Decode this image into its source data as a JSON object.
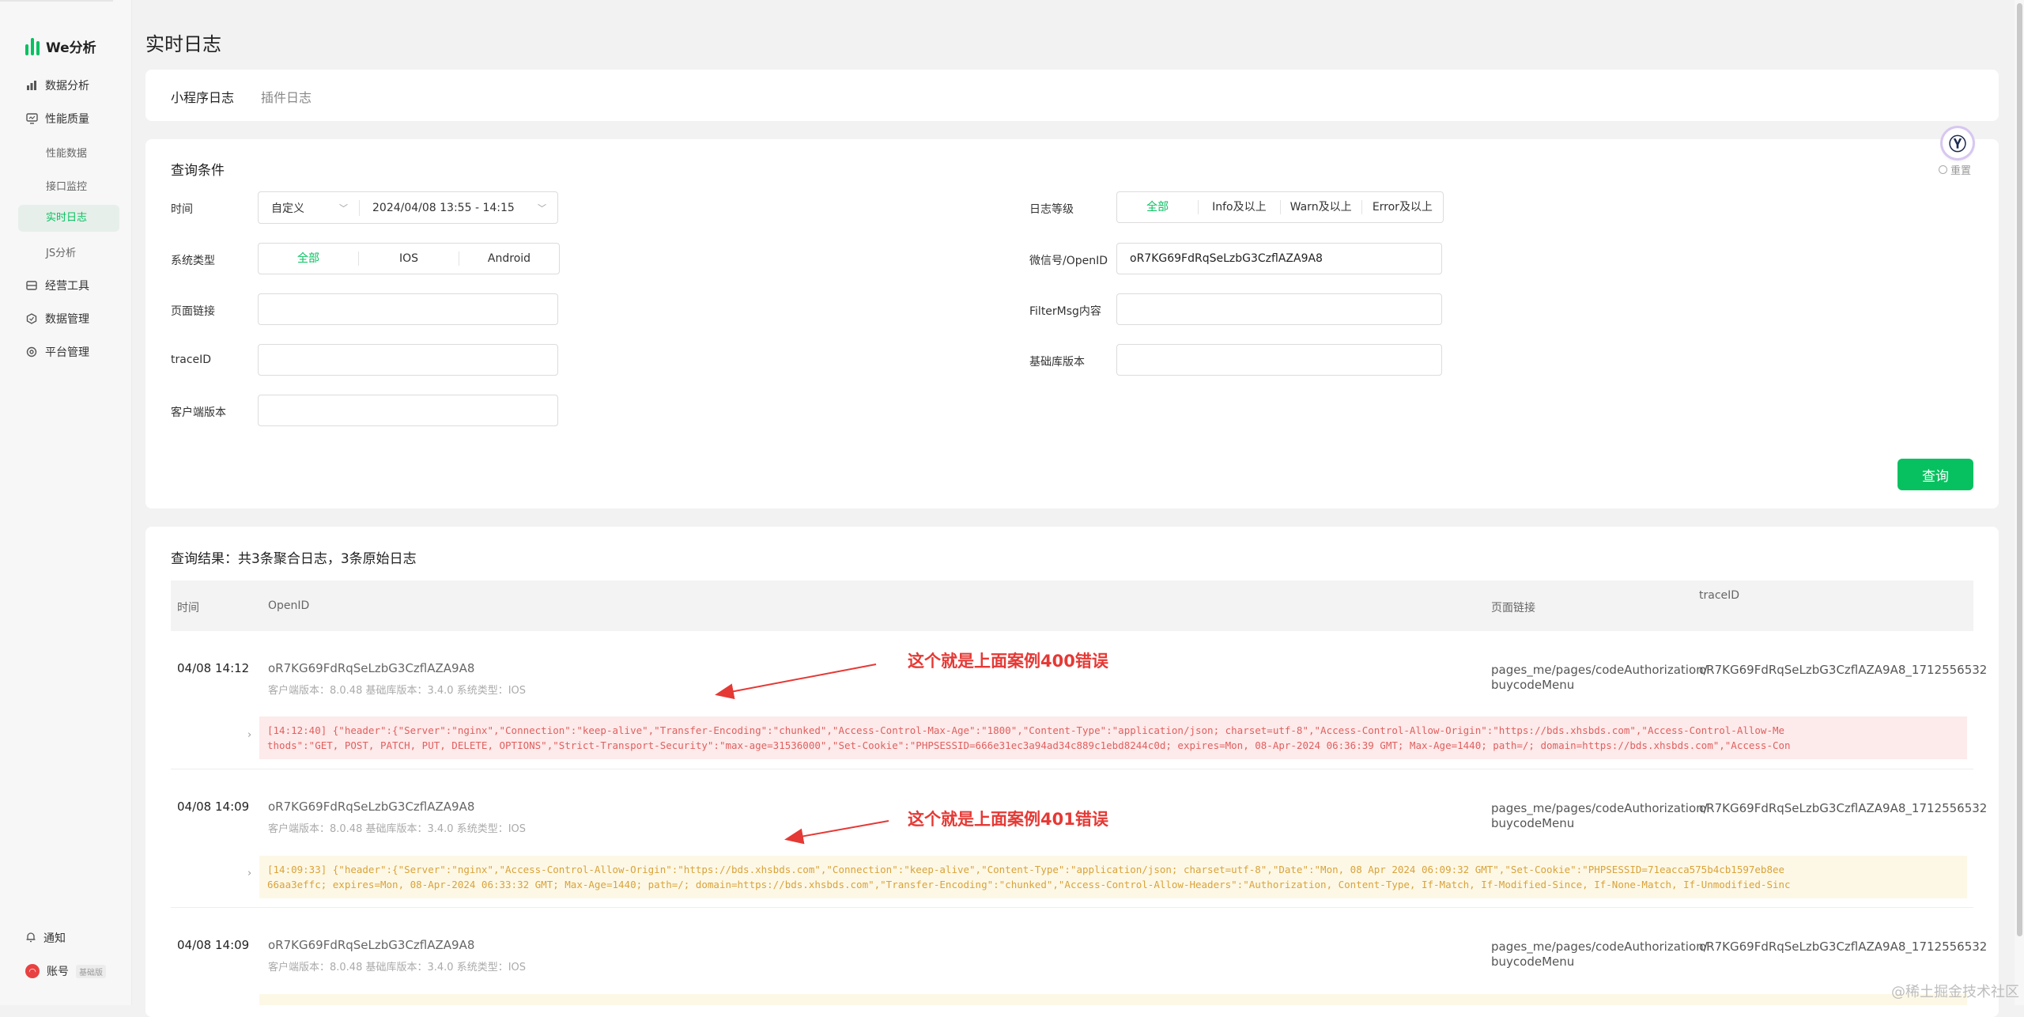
{
  "app": {
    "logo_text": "We分析"
  },
  "sidebar": {
    "items": [
      {
        "label": "数据分析",
        "icon": "bar-chart-icon"
      },
      {
        "label": "性能质量",
        "icon": "monitor-icon"
      },
      {
        "label": "性能数据"
      },
      {
        "label": "接口监控"
      },
      {
        "label": "实时日志",
        "active": true
      },
      {
        "label": "JS分析"
      },
      {
        "label": "经营工具",
        "icon": "toolbox-icon"
      },
      {
        "label": "数据管理",
        "icon": "hexagon-icon"
      },
      {
        "label": "平台管理",
        "icon": "gear-icon"
      }
    ],
    "bottom": {
      "notify": "通知",
      "account": "账号",
      "account_tag": "基础版"
    }
  },
  "page": {
    "title": "实时日志"
  },
  "tabs": [
    {
      "label": "小程序日志",
      "active": true
    },
    {
      "label": "插件日志",
      "active": false
    }
  ],
  "query": {
    "title": "查询条件",
    "reset": "重置",
    "time_label": "时间",
    "time_mode": "自定义",
    "time_range": "2024/04/08 13:55 - 14:15",
    "system_label": "系统类型",
    "system_options": [
      "全部",
      "IOS",
      "Android"
    ],
    "page_label": "页面链接",
    "trace_label": "traceID",
    "client_label": "客户端版本",
    "level_label": "日志等级",
    "level_options": [
      "全部",
      "Info及以上",
      "Warn及以上",
      "Error及以上"
    ],
    "openid_label": "微信号/OpenID",
    "openid_value": "oR7KG69FdRqSeLzbG3CzflAZA9A8",
    "filter_label": "FilterMsg内容",
    "lib_label": "基础库版本",
    "submit": "查询"
  },
  "results": {
    "summary": "查询结果：共3条聚合日志，3条原始日志",
    "columns": [
      "时间",
      "OpenID",
      "页面链接",
      "traceID"
    ],
    "rows": [
      {
        "time": "04/08 14:12",
        "openid": "oR7KG69FdRqSeLzbG3CzflAZA9A8",
        "meta": "客户端版本：8.0.48 基础库版本：3.4.0 系统类型：IOS",
        "page_line1": "pages_me/pages/codeAuthorization/",
        "page_line2": "buycodeMenu",
        "trace": "oR7KG69FdRqSeLzbG3CzflAZA9A8_1712556532",
        "log_level": "error",
        "log_line1": "[14:12:40] {\"header\":{\"Server\":\"nginx\",\"Connection\":\"keep-alive\",\"Transfer-Encoding\":\"chunked\",\"Access-Control-Max-Age\":\"1800\",\"Content-Type\":\"application/json; charset=utf-8\",\"Access-Control-Allow-Origin\":\"https://bds.xhsbds.com\",\"Access-Control-Allow-Me",
        "log_line2": "thods\":\"GET, POST, PATCH, PUT, DELETE, OPTIONS\",\"Strict-Transport-Security\":\"max-age=31536000\",\"Set-Cookie\":\"PHPSESSID=666e31ec3a94ad34c889c1ebd8244c0d; expires=Mon, 08-Apr-2024 06:36:39 GMT; Max-Age=1440; path=/; domain=https://bds.xhsbds.com\",\"Access-Con"
      },
      {
        "time": "04/08 14:09",
        "openid": "oR7KG69FdRqSeLzbG3CzflAZA9A8",
        "meta": "客户端版本：8.0.48 基础库版本：3.4.0 系统类型：IOS",
        "page_line1": "pages_me/pages/codeAuthorization/",
        "page_line2": "buycodeMenu",
        "trace": "oR7KG69FdRqSeLzbG3CzflAZA9A8_1712556532",
        "log_level": "warn",
        "log_line1": "[14:09:33] {\"header\":{\"Server\":\"nginx\",\"Access-Control-Allow-Origin\":\"https://bds.xhsbds.com\",\"Connection\":\"keep-alive\",\"Content-Type\":\"application/json; charset=utf-8\",\"Date\":\"Mon, 08 Apr 2024 06:09:32 GMT\",\"Set-Cookie\":\"PHPSESSID=71eacca575b4cb1597eb8ee",
        "log_line2": "66aa3effc; expires=Mon, 08-Apr-2024 06:33:32 GMT; Max-Age=1440; path=/; domain=https://bds.xhsbds.com\",\"Transfer-Encoding\":\"chunked\",\"Access-Control-Allow-Headers\":\"Authorization, Content-Type, If-Match, If-Modified-Since, If-None-Match, If-Unmodified-Sinc"
      },
      {
        "time": "04/08 14:09",
        "openid": "oR7KG69FdRqSeLzbG3CzflAZA9A8",
        "meta": "客户端版本：8.0.48 基础库版本：3.4.0 系统类型：IOS",
        "page_line1": "pages_me/pages/codeAuthorization/",
        "page_line2": "buycodeMenu",
        "trace": "oR7KG69FdRqSeLzbG3CzflAZA9A8_1712556532"
      }
    ]
  },
  "annotations": [
    "这个就是上面案例400错误",
    "这个就是上面案例401错误"
  ],
  "watermark": "@稀土掘金技术社区",
  "colors": {
    "brand": "#07c160",
    "annotation": "#e53935",
    "error_bg": "#fdeaea",
    "warn_bg": "#fdf8e6"
  }
}
